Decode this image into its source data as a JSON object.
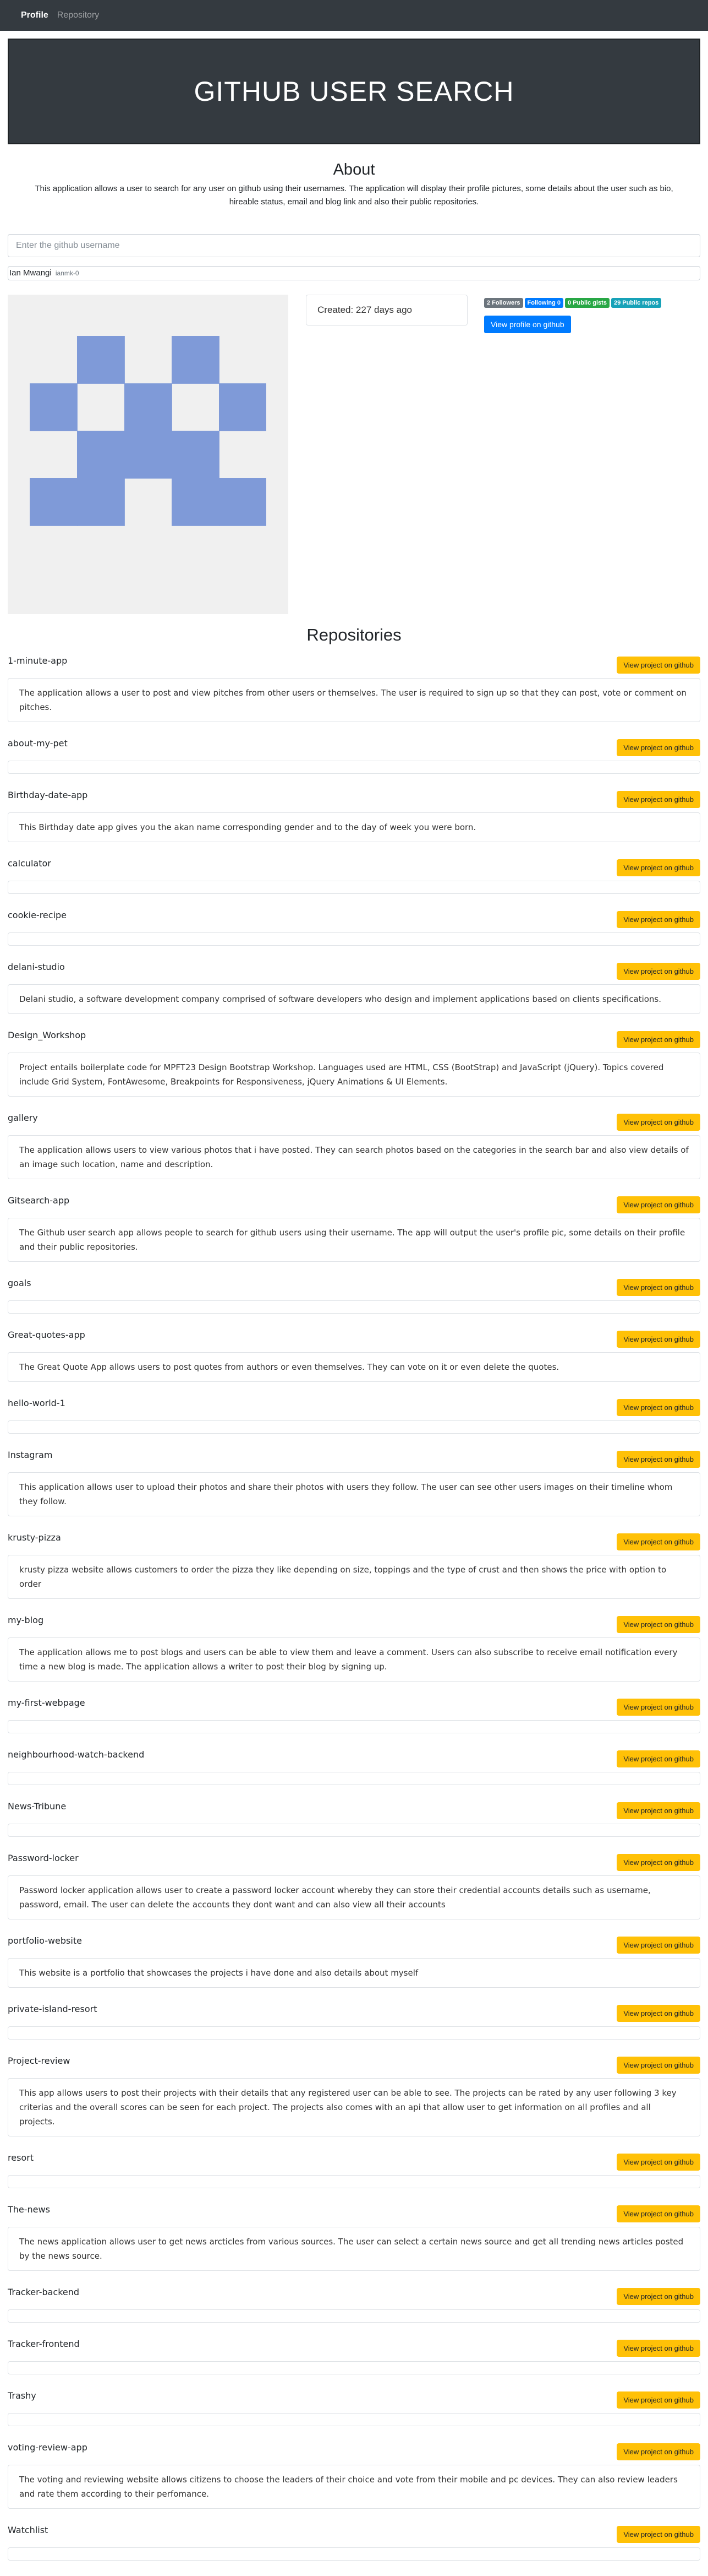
{
  "nav": {
    "brand": "Profile",
    "link": "Repository"
  },
  "hero": {
    "title": "GITHUB USER SEARCH"
  },
  "about": {
    "heading": "About",
    "text": "This application allows a user to search for any user on github using their usernames. The application will display their profile pictures, some details about the user such as bio, hireable status, email and blog link and also their public repositories."
  },
  "search": {
    "placeholder": "Enter the github username",
    "value": ""
  },
  "user": {
    "name": "Ian Mwangi",
    "login": "ianmk-0"
  },
  "profile": {
    "created": "Created: 227 days ago",
    "followers": "2 Followers",
    "following": "Following 0",
    "gists": "0 Public gists",
    "repos": "29 Public repos",
    "view_label": "View profile on github",
    "avatar_color": "#7f9ad8"
  },
  "repos_title": "Repositories",
  "repo_button_label": "View project on github",
  "repos": [
    {
      "name": "1-minute-app",
      "description": "The application allows a user to post and view pitches from other users or themselves. The user is required to sign up so that they can post, vote or comment on pitches."
    },
    {
      "name": "about-my-pet",
      "description": ""
    },
    {
      "name": "Birthday-date-app",
      "description": "This Birthday date app gives you the akan name corresponding gender and to the day of week you were born."
    },
    {
      "name": "calculator",
      "description": ""
    },
    {
      "name": "cookie-recipe",
      "description": ""
    },
    {
      "name": "delani-studio",
      "description": "Delani studio, a software development company comprised of software developers who design and implement applications based on clients specifications."
    },
    {
      "name": "Design_Workshop",
      "description": "Project entails boilerplate code for MPFT23 Design Bootstrap Workshop. Languages used are HTML, CSS (BootStrap) and JavaScript (jQuery). Topics covered include Grid System, FontAwesome, Breakpoints for Responsiveness, jQuery Animations & UI Elements."
    },
    {
      "name": "gallery",
      "description": "The application allows users to view various photos that i have posted. They can search photos based on the categories in the search bar and also view details of an image such location, name and description."
    },
    {
      "name": "Gitsearch-app",
      "description": "The Github user search app allows people to search for github users using their username. The app will output the user's profile pic, some details on their profile and their public repositories."
    },
    {
      "name": "goals",
      "description": ""
    },
    {
      "name": "Great-quotes-app",
      "description": "The Great Quote App allows users to post quotes from authors or even themselves. They can vote on it or even delete the quotes."
    },
    {
      "name": "hello-world-1",
      "description": ""
    },
    {
      "name": "Instagram",
      "description": "This application allows user to upload their photos and share their photos with users they follow. The user can see other users images on their timeline whom they follow."
    },
    {
      "name": "krusty-pizza",
      "description": "krusty pizza website allows customers to order the pizza they like depending on size, toppings and the type of crust and then shows the price with option to order"
    },
    {
      "name": "my-blog",
      "description": "The application allows me to post blogs and users can be able to view them and leave a comment. Users can also subscribe to receive email notification every time a new blog is made. The application allows a writer to post their blog by signing up."
    },
    {
      "name": "my-first-webpage",
      "description": ""
    },
    {
      "name": "neighbourhood-watch-backend",
      "description": ""
    },
    {
      "name": "News-Tribune",
      "description": ""
    },
    {
      "name": "Password-locker",
      "description": "Password locker application allows user to create a password locker account whereby they can store their credential accounts details such as username, password, email. The user can delete the accounts they dont want and can also view all their accounts"
    },
    {
      "name": "portfolio-website",
      "description": "This website is a portfolio that showcases the projects i have done and also details about myself"
    },
    {
      "name": "private-island-resort",
      "description": ""
    },
    {
      "name": "Project-review",
      "description": "This app allows users to post their projects with their details that any registered user can be able to see. The projects can be rated by any user following 3 key criterias and the overall scores can be seen for each project. The projects also comes with an api that allow user to get information on all profiles and all projects."
    },
    {
      "name": "resort",
      "description": ""
    },
    {
      "name": "The-news",
      "description": "The news application allows user to get news arcticles from various sources. The user can select a certain news source and get all trending news articles posted by the news source."
    },
    {
      "name": "Tracker-backend",
      "description": ""
    },
    {
      "name": "Tracker-frontend",
      "description": ""
    },
    {
      "name": "Trashy",
      "description": ""
    },
    {
      "name": "voting-review-app",
      "description": "The voting and reviewing website allows citizens to choose the leaders of their choice and vote from their mobile and pc devices. They can also review leaders and rate them according to their perfomance."
    },
    {
      "name": "Watchlist",
      "description": ""
    }
  ]
}
